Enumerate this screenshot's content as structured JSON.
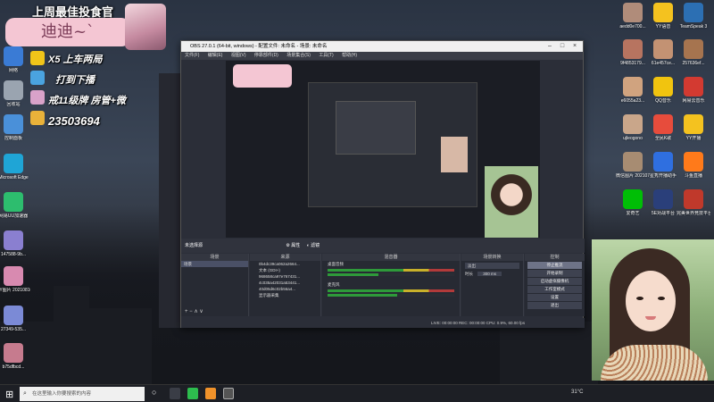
{
  "overlay": {
    "top_banner": "上周最佳投食官",
    "name_card": "迪迪~`",
    "line1": "X5 上车两局",
    "line2": "打到下播",
    "line3": "戒11级牌 房管+微",
    "line4": "23503694"
  },
  "desktop_left": [
    {
      "label": "网络",
      "icon": "network-icon",
      "color": "#3a7bd5"
    },
    {
      "label": "回收站",
      "icon": "recycle-bin-icon",
      "color": "#9aa4b0"
    },
    {
      "label": "控制面板",
      "icon": "control-panel-icon",
      "color": "#4a90d9"
    },
    {
      "label": "Microsoft Edge",
      "icon": "edge-icon",
      "color": "#1fa5d6"
    },
    {
      "label": "网易UU加速器",
      "icon": "uu-icon",
      "color": "#2dbd6e"
    },
    {
      "label": "147588-9b...",
      "icon": "file-icon",
      "color": "#8a7fd0"
    },
    {
      "label": "YY图片 20210810...",
      "icon": "image-icon",
      "color": "#d88ab0"
    },
    {
      "label": "27349-535...",
      "icon": "image-icon",
      "color": "#7b8ad6"
    },
    {
      "label": "b75dfbcd...",
      "icon": "image-icon",
      "color": "#c67b8e"
    }
  ],
  "desktop_right": [
    {
      "label": "aedd0e700...",
      "icon": "image-icon",
      "color": "#b08c7a"
    },
    {
      "label": "YY语音",
      "icon": "yy-icon",
      "color": "#f4c21f"
    },
    {
      "label": "TeamSpeak 3",
      "icon": "teamspeak-icon",
      "color": "#2c6fb3"
    },
    {
      "label": "9f4853179...",
      "icon": "image-icon",
      "color": "#b77460"
    },
    {
      "label": "61e457ce...",
      "icon": "image-icon",
      "color": "#c39273"
    },
    {
      "label": "257636ef...",
      "icon": "image-icon",
      "color": "#a6744f"
    },
    {
      "label": "e6055a23...",
      "icon": "image-icon",
      "color": "#d0a37f"
    },
    {
      "label": "QQ音乐",
      "icon": "qq-music-icon",
      "color": "#f1c40f"
    },
    {
      "label": "网易云音乐",
      "icon": "netease-music-icon",
      "color": "#d33a31"
    },
    {
      "label": "ujleogono",
      "icon": "image-icon",
      "color": "#c9a68a"
    },
    {
      "label": "全民K歌",
      "icon": "karaoke-icon",
      "color": "#e74c3c"
    },
    {
      "label": "YY开播",
      "icon": "yy-live-icon",
      "color": "#f4c21f"
    },
    {
      "label": "微信图片 2021070...",
      "icon": "image-icon",
      "color": "#a78c72"
    },
    {
      "label": "星秀开播助手",
      "icon": "star-icon",
      "color": "#2f6fe0"
    },
    {
      "label": "斗鱼直播",
      "icon": "douyu-icon",
      "color": "#ff7a1a"
    },
    {
      "label": "爱奇艺",
      "icon": "iqiyi-icon",
      "color": "#00be06"
    },
    {
      "label": "5E对战平台",
      "icon": "5e-icon",
      "color": "#2a3f7a"
    },
    {
      "label": "完美世界竞技平台",
      "icon": "perfect-world-icon",
      "color": "#c0392b"
    }
  ],
  "obs": {
    "title": "OBS 27.0.1 (64-bit, windows) - 配置文件: 未命名 - 场景: 未命名",
    "menu": [
      "文件(F)",
      "编辑(E)",
      "视图(V)",
      "停靠部件(D)",
      "场景集合(S)",
      "工具(T)",
      "帮助(H)"
    ],
    "toolbar_left": "未选择源",
    "toolbar_props": "属性",
    "toolbar_filters": "滤镜",
    "docks": {
      "scenes": "场景",
      "sources": "来源",
      "mixer": "混音器",
      "transitions": "场景转换",
      "controls": "控制"
    },
    "scene_item": "场景",
    "sources": [
      "0b4dc39ca062a2664...",
      "文本 (GDI+)",
      "968658ca97e767431...",
      "4c035a42031a53441...",
      "40d05d6c02b56a4...",
      "显示器采集"
    ],
    "mixer_tracks": [
      "桌面音频",
      "麦克风"
    ],
    "transition_value": "淡出",
    "duration_label": "时长",
    "duration_value": "300 ms",
    "controls": [
      "停止推流",
      "开始录制",
      "启动虚拟摄像机",
      "工作室模式",
      "设置",
      "退出"
    ],
    "status": "LIVE: 00:00:00   REC: 00:00:00   CPU: 0.9%, 60.00 fps"
  },
  "taskbar": {
    "search_placeholder": "在这里输入你要搜索的内容",
    "clock": "31°C"
  }
}
